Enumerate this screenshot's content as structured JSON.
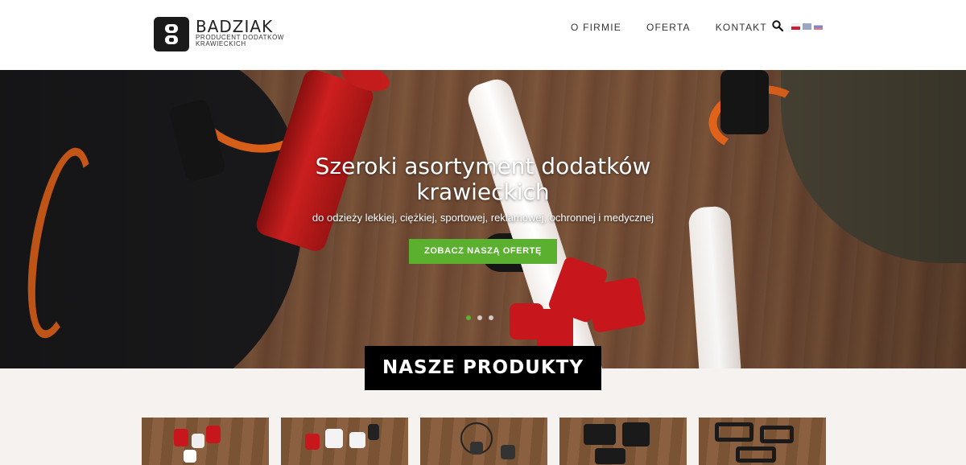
{
  "header": {
    "logo": {
      "name": "BADZIAK",
      "tagline_line1": "PRODUCENT DODATKÓW",
      "tagline_line2": "KRAWIECKICH"
    },
    "nav": [
      {
        "label": "O FIRMIE"
      },
      {
        "label": "OFERTA"
      },
      {
        "label": "KONTAKT"
      }
    ],
    "search_icon": "search-icon",
    "languages": [
      {
        "code": "pl",
        "icon": "flag-pl-icon"
      },
      {
        "code": "en",
        "icon": "flag-gb-icon"
      },
      {
        "code": "ru",
        "icon": "flag-ru-icon"
      }
    ]
  },
  "hero": {
    "title_line1": "Szeroki asortyment dodatków",
    "title_line2": "krawieckich",
    "subtitle": "do odzieży lekkiej, ciężkiej, sportowej, reklamowej, ochronnej i medycznej",
    "cta_label": "ZOBACZ NASZĄ OFERTĘ",
    "slides_total": 3,
    "active_slide": 1
  },
  "products": {
    "title": "NASZE PRODUKTY",
    "thumbnails": [
      {
        "name": "product-thumb-stoppers"
      },
      {
        "name": "product-thumb-cord-ends"
      },
      {
        "name": "product-thumb-toggles"
      },
      {
        "name": "product-thumb-buckles"
      },
      {
        "name": "product-thumb-sliders"
      }
    ]
  },
  "colors": {
    "accent_green": "#5bb12f",
    "header_text": "#333333",
    "title_box": "#000000"
  }
}
